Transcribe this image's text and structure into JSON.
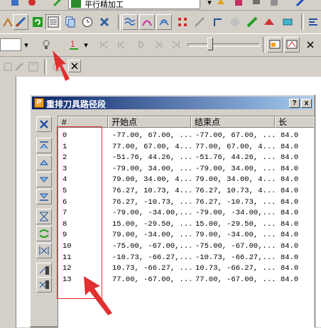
{
  "toolbar": {
    "row1": {
      "combo_value": "平行精加工"
    },
    "row3": {
      "slider_level": 0.3
    }
  },
  "dialog": {
    "title": "重排刀具路径段",
    "close_label": "x",
    "help_label": "?",
    "columns": [
      "#",
      "开始点",
      "结束点",
      "长"
    ],
    "rows": [
      {
        "id": "0",
        "start": "-77.00, 67.00, ...",
        "end": "-77.00, 67.00, ...",
        "len": "84.0"
      },
      {
        "id": "1",
        "start": "77.00, 67.00, 4...",
        "end": "77.00, 67.00, 4...",
        "len": "84.0"
      },
      {
        "id": "2",
        "start": "-51.76, 44.26, ...",
        "end": "-51.76, 44.26, ...",
        "len": "84.0"
      },
      {
        "id": "3",
        "start": "-79.00, 34.00, ...",
        "end": "-79.00, 34.00, ...",
        "len": "84.0"
      },
      {
        "id": "4",
        "start": "79.00, 34.00, 4...",
        "end": "79.00, 34.00, 4...",
        "len": "84.0"
      },
      {
        "id": "5",
        "start": "76.27, 10.73, 4...",
        "end": "76.27, 10.73, 4...",
        "len": "84.0"
      },
      {
        "id": "6",
        "start": "76.27, -10.73, ...",
        "end": "76.27, -10.73, ...",
        "len": "84.0"
      },
      {
        "id": "7",
        "start": "-79.00, -34.00,...",
        "end": "-79.00, -34.00,...",
        "len": "84.0"
      },
      {
        "id": "8",
        "start": "15.00, -29.50, ...",
        "end": "15.00, -29.50, ...",
        "len": "84.0"
      },
      {
        "id": "9",
        "start": "79.00, -34.00, ...",
        "end": "79.00, -34.00, ...",
        "len": "84.0"
      },
      {
        "id": "10",
        "start": "-75.00, -67.00,...",
        "end": "-75.00, -67.00,...",
        "len": "84.0"
      },
      {
        "id": "11",
        "start": "-10.73, -66.27,...",
        "end": "-10.73, -66.27,...",
        "len": "84.0"
      },
      {
        "id": "12",
        "start": "10.73, -66.27, ...",
        "end": "10.73, -66.27, ...",
        "len": "84.0"
      },
      {
        "id": "13",
        "start": "77.00, -67.00, ...",
        "end": "77.00, -67.00, ...",
        "len": "84.0"
      }
    ]
  },
  "colors": {
    "title_from": "#0a246a",
    "title_to": "#a6caf0",
    "annotation": "#e03030"
  }
}
